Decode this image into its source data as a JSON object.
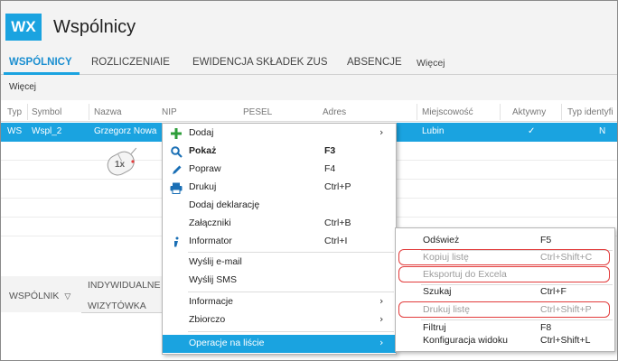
{
  "app": {
    "badge": "WX",
    "title": "Wspólnicy"
  },
  "tabs": [
    {
      "label": "WSPÓLNICY",
      "active": true
    },
    {
      "label": "ROZLICZENIAIE",
      "active": false
    },
    {
      "label": "EWIDENCJA SKŁADEK ZUS",
      "active": false
    },
    {
      "label": "ABSENCJE",
      "active": false
    },
    {
      "label": "Więcej",
      "active": false
    }
  ],
  "subbar": {
    "more": "Więcej"
  },
  "grid": {
    "columns": [
      "Typ",
      "Symbol",
      "Nazwa",
      "NIP",
      "PESEL",
      "Adres",
      "Miejscowość",
      "Aktywny",
      "Typ identyfi"
    ],
    "selected_row": {
      "typ": "WS",
      "symbol": "Wspl_2",
      "nazwa": "Grzegorz Nowa",
      "miejscowosc": "Lubin",
      "aktywny": "✓",
      "typ_ident": "N"
    }
  },
  "cursor_hint": "1x",
  "bottom_tabs": {
    "wspolnik": "WSPÓLNIK",
    "indywidualne": "INDYWIDUALNE",
    "wizytowka": "WIZYTÓWKA"
  },
  "context_menu": [
    {
      "label": "Dodaj",
      "shortcut": "",
      "icon": "plus-icon",
      "submenu": true
    },
    {
      "label": "Pokaż",
      "shortcut": "F3",
      "icon": "search-icon",
      "bold": true
    },
    {
      "label": "Popraw",
      "shortcut": "F4",
      "icon": "pencil-icon"
    },
    {
      "label": "Drukuj",
      "shortcut": "Ctrl+P",
      "icon": "printer-icon"
    },
    {
      "label": "Dodaj deklarację",
      "shortcut": ""
    },
    {
      "label": "Załączniki",
      "shortcut": "Ctrl+B"
    },
    {
      "label": "Informator",
      "shortcut": "Ctrl+I",
      "icon": "info-icon"
    },
    {
      "label": "Wyślij e-mail",
      "shortcut": ""
    },
    {
      "label": "Wyślij SMS",
      "shortcut": ""
    },
    {
      "label": "Informacje",
      "shortcut": "",
      "submenu": true
    },
    {
      "label": "Zbiorczo",
      "shortcut": "",
      "submenu": true
    },
    {
      "label": "Operacje na liście",
      "shortcut": "",
      "submenu": true,
      "highlighted": true
    }
  ],
  "submenu": [
    {
      "label": "Odśwież",
      "shortcut": "F5",
      "disabled": false
    },
    {
      "label": "Kopiuj listę",
      "shortcut": "Ctrl+Shift+C",
      "disabled": true,
      "boxed": true
    },
    {
      "label": "Eksportuj do Excela",
      "shortcut": "",
      "disabled": true,
      "boxed": true
    },
    {
      "label": "Szukaj",
      "shortcut": "Ctrl+F",
      "disabled": false
    },
    {
      "label": "Drukuj listę",
      "shortcut": "Ctrl+Shift+P",
      "disabled": true,
      "boxed": true
    },
    {
      "label": "Filtruj",
      "shortcut": "F8",
      "disabled": false
    },
    {
      "label": "Konfiguracja widoku",
      "shortcut": "Ctrl+Shift+L",
      "disabled": false
    }
  ],
  "colors": {
    "accent": "#1aa3e0",
    "highlight_box": "#e23c3c",
    "disabled_text": "#9c9c9c"
  }
}
